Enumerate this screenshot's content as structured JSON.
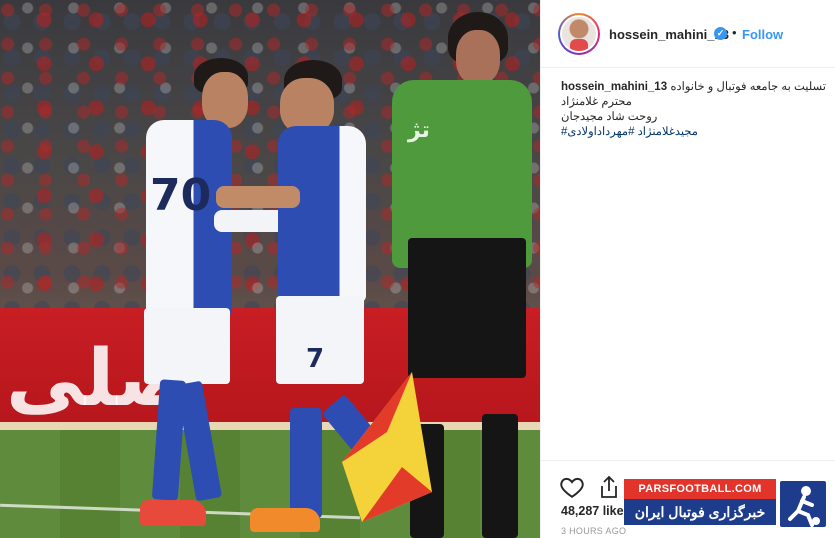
{
  "post": {
    "username": "hossein_mahini_13",
    "verified_glyph": "✓",
    "separator": "•",
    "follow_label": "Follow",
    "caption_lines": [
      "تسلیت به جامعه فوتبال و خانواده",
      "محترم غلامنژاد",
      "روحت شاد مجیدجان",
      "مجیدغلامنژاد #مهرداداولادی#"
    ],
    "likes": "48,287 like",
    "timestamp": "3 HOURS AGO"
  },
  "photo": {
    "ad_board_text": "صلى",
    "jersey_numbers": {
      "left_player": "70",
      "right_player": "7"
    },
    "referee_shirt_text": "تژ"
  },
  "watermark": {
    "top_text": "PARSFOOTBALL.COM",
    "bottom_text": "خبرگزاری فوتبال ایران"
  },
  "icons": {
    "like": "heart-icon",
    "share": "share-icon",
    "verified": "verified-badge-icon"
  },
  "colors": {
    "link_blue": "#3897f0",
    "hashtag_blue": "#003569",
    "muted_gray": "#999999",
    "esteghlal_blue": "#2d4db3",
    "watermark_red": "#e2342b",
    "watermark_navy": "#1e3c8c"
  }
}
